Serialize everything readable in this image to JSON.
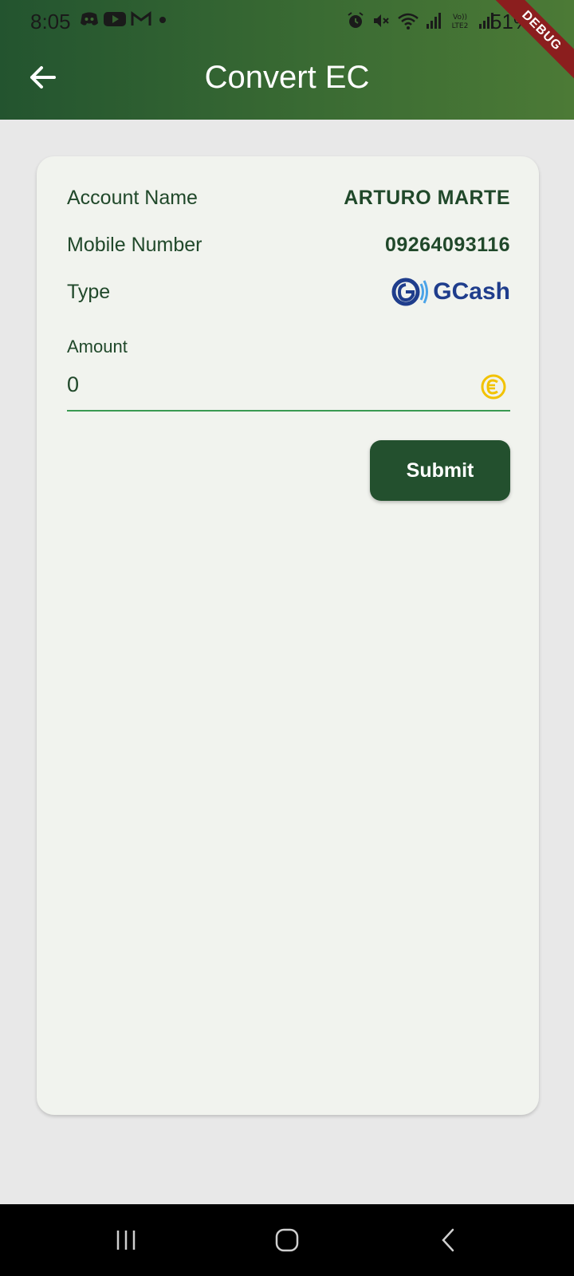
{
  "status_bar": {
    "time": "8:05",
    "battery": "51%",
    "left_icons": [
      "discord-icon",
      "youtube-icon",
      "gmail-icon",
      "dot-icon"
    ],
    "right_icons": [
      "alarm-icon",
      "mute-icon",
      "wifi-icon",
      "signal-icon",
      "volte-icon",
      "signal-icon"
    ]
  },
  "debug_banner": "DEBUG",
  "header": {
    "title": "Convert EC",
    "back_icon": "arrow-left-icon"
  },
  "details": {
    "account_name_label": "Account Name",
    "account_name_value": "ARTURO MARTE",
    "mobile_label": "Mobile Number",
    "mobile_value": "09264093116",
    "type_label": "Type",
    "type_value": "GCash"
  },
  "amount": {
    "label": "Amount",
    "value": "0",
    "currency_icon": "ec-coin-icon"
  },
  "actions": {
    "submit_label": "Submit"
  },
  "colors": {
    "primary": "#23502e",
    "accent_line": "#3a9a52",
    "coin": "#f2c200",
    "gcash_blue": "#1f3d8c"
  },
  "navbar": {
    "buttons": [
      "recents-icon",
      "home-icon",
      "back-icon"
    ]
  }
}
